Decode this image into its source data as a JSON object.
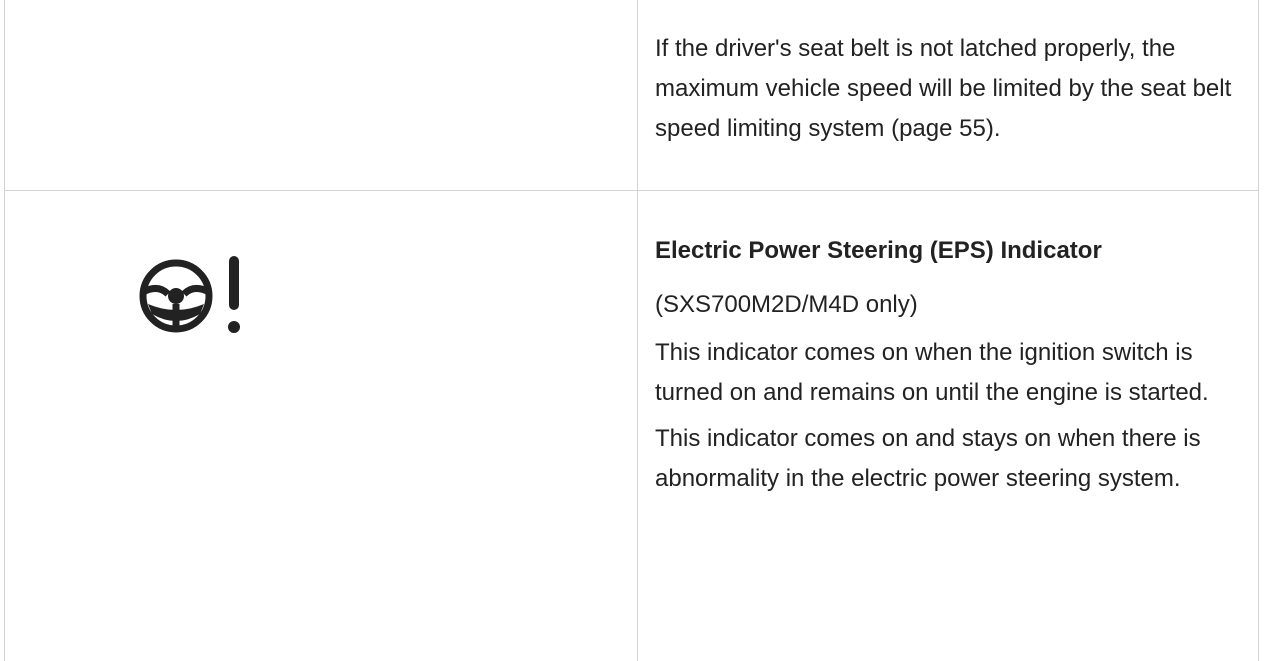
{
  "rows": [
    {
      "icon": "",
      "text": "If the driver's seat belt is not latched properly, the maximum vehicle speed will be limited by the seat belt speed limiting system (page 55)."
    },
    {
      "icon": "eps-steering-warning-icon",
      "heading": "Electric Power Steering (EPS) Indicator",
      "model_note": "(SXS700M2D/M4D only)",
      "paragraph1": "This indicator comes on when the ignition switch is turned on and remains on until the engine is started.",
      "paragraph2": "This indicator comes on and stays on when there is abnormality in the electric power steering system."
    }
  ],
  "colors": {
    "border": "#d3d3d3",
    "text": "#222222",
    "icon": "#222222"
  }
}
